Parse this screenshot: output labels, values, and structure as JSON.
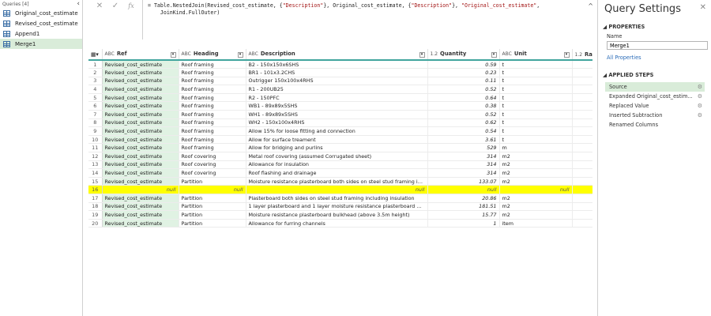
{
  "queries": {
    "header": "Queries [4]",
    "items": [
      "Original_cost_estimate",
      "Revised_cost_estimate",
      "Append1",
      "Merge1"
    ]
  },
  "formula": {
    "cancel_icon": "✕",
    "confirm_icon": "✓",
    "fx_label": "fx",
    "seg1": "= Table.NestedJoin(Revised_cost_estimate, {",
    "s1": "\"Description\"",
    "seg2": "}, Original_cost_estimate, {",
    "s2": "\"Description\"",
    "seg3": "}, ",
    "s3": "\"Original_cost_estimate\"",
    "seg4": ",",
    "line2": "    JoinKind.FullOuter)"
  },
  "grid": {
    "columns": [
      {
        "type": "ABC",
        "name": "Ref"
      },
      {
        "type": "ABC",
        "name": "Heading"
      },
      {
        "type": "ABC",
        "name": "Description"
      },
      {
        "type": "1.2",
        "name": "Quantity"
      },
      {
        "type": "ABC",
        "name": "Unit"
      },
      {
        "type": "1.2",
        "name": "Rat"
      }
    ],
    "rows": [
      [
        "1",
        "Revised_cost_estimate",
        "Roof framing",
        "B2 - 150x150x6SHS",
        "0.59",
        "t"
      ],
      [
        "2",
        "Revised_cost_estimate",
        "Roof framing",
        "BR1 - 101x3.2CHS",
        "0.23",
        "t"
      ],
      [
        "3",
        "Revised_cost_estimate",
        "Roof framing",
        "Outrigger 150x100x4RHS",
        "0.11",
        "t"
      ],
      [
        "4",
        "Revised_cost_estimate",
        "Roof framing",
        "R1 - 200UB25",
        "0.52",
        "t"
      ],
      [
        "5",
        "Revised_cost_estimate",
        "Roof framing",
        "R2 - 150PFC",
        "0.64",
        "t"
      ],
      [
        "6",
        "Revised_cost_estimate",
        "Roof framing",
        "WB1 - 89x89x5SHS",
        "0.38",
        "t"
      ],
      [
        "7",
        "Revised_cost_estimate",
        "Roof framing",
        "WH1 - 89x89x5SHS",
        "0.52",
        "t"
      ],
      [
        "8",
        "Revised_cost_estimate",
        "Roof framing",
        "WH2 - 150x100x4RHS",
        "0.62",
        "t"
      ],
      [
        "9",
        "Revised_cost_estimate",
        "Roof framing",
        "Allow 15% for loose fitting and connection",
        "0.54",
        "t"
      ],
      [
        "10",
        "Revised_cost_estimate",
        "Roof framing",
        "Allow for surface treament",
        "3.61",
        "t"
      ],
      [
        "11",
        "Revised_cost_estimate",
        "Roof framing",
        "Allow for bridging and purlins",
        "529",
        "m"
      ],
      [
        "12",
        "Revised_cost_estimate",
        "Roof covering",
        "Metal roof covering (assumed Corrugated sheet)",
        "314",
        "m2"
      ],
      [
        "13",
        "Revised_cost_estimate",
        "Roof covering",
        "Allowance for insulation",
        "314",
        "m2"
      ],
      [
        "14",
        "Revised_cost_estimate",
        "Roof covering",
        "Roof flashing and drainage",
        "314",
        "m2"
      ],
      [
        "15",
        "Revised_cost_estimate",
        "Partition",
        "Moisture resistance plasterboard both sides on steel stud framing incl...",
        "133.07",
        "m2"
      ],
      [
        "16",
        "null",
        "null",
        "null",
        "null",
        "null"
      ],
      [
        "17",
        "Revised_cost_estimate",
        "Partition",
        "Plasterboard both sides on steel stud framing including insulation",
        "20.86",
        "m2"
      ],
      [
        "18",
        "Revised_cost_estimate",
        "Partition",
        "1 layer plasterboard and 1 layer moisture resistance plasterboard each...",
        "181.51",
        "m2"
      ],
      [
        "19",
        "Revised_cost_estimate",
        "Partition",
        "Moisture resistance plasterboard bulkhead (above 3.5m height)",
        "15.77",
        "m2"
      ],
      [
        "20",
        "Revised_cost_estimate",
        "Partition",
        "Allowance for furring channels",
        "1",
        "item"
      ]
    ],
    "highlight_color": "#ffff00",
    "highlight_row": 16
  },
  "settings": {
    "title": "Query Settings",
    "close_icon": "✕",
    "properties_header": "PROPERTIES",
    "name_label": "Name",
    "name_value": "Merge1",
    "all_properties": "All Properties",
    "applied_steps_header": "APPLIED STEPS",
    "steps": [
      {
        "label": "Source",
        "gear": true
      },
      {
        "label": "Expanded Original_cost_estim...",
        "gear": true
      },
      {
        "label": "Replaced Value",
        "gear": true
      },
      {
        "label": "Inserted Subtraction",
        "gear": true
      },
      {
        "label": "Renamed Columns",
        "gear": false
      }
    ]
  },
  "colors": {
    "selected_bg": "#d9ecd9",
    "accent": "#41a59e",
    "link": "#2b6cb8"
  }
}
